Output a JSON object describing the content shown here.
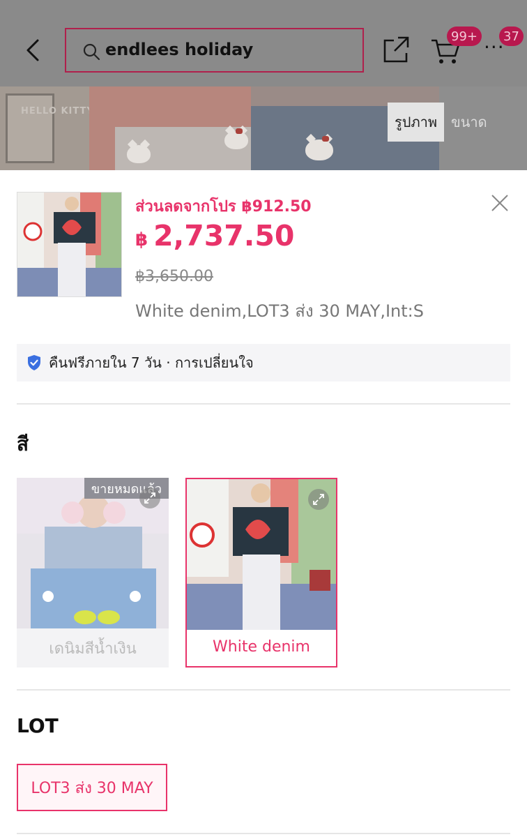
{
  "header": {
    "search_value": "endlees holiday",
    "cart_badge": "99+",
    "more_badge": "37",
    "more_label": "···"
  },
  "hero": {
    "tabs": [
      {
        "label": "รูปภาพ",
        "active": true
      },
      {
        "label": "ขนาด",
        "active": false
      }
    ]
  },
  "product": {
    "promo_discount": "ส่วนลดจากโปร ฿912.50",
    "currency": "฿",
    "price": "2,737.50",
    "original_price": "฿3,650.00",
    "selected_variant": "White denim,LOT3 ส่ง 30 MAY,Int:S"
  },
  "guarantee": {
    "text": "คืนฟรีภายใน 7 วัน · การเปลี่ยนใจ",
    "icon": "shield-check-icon"
  },
  "color_section": {
    "title": "สี",
    "options": [
      {
        "label": "เดนิมสีน้ำเงิน",
        "badge": "ขายหมดแล้ว",
        "selected": false,
        "sold_out": true
      },
      {
        "label": "White denim",
        "badge": "",
        "selected": true,
        "sold_out": false
      }
    ]
  },
  "lot_section": {
    "title": "LOT",
    "options": [
      {
        "label": "LOT3 ส่ง 30 MAY",
        "selected": true
      }
    ]
  },
  "colors": {
    "accent": "#e8336a",
    "search_border": "#b0204c",
    "badge_bg": "#b8184e",
    "overlay": "#8a8a8a"
  }
}
